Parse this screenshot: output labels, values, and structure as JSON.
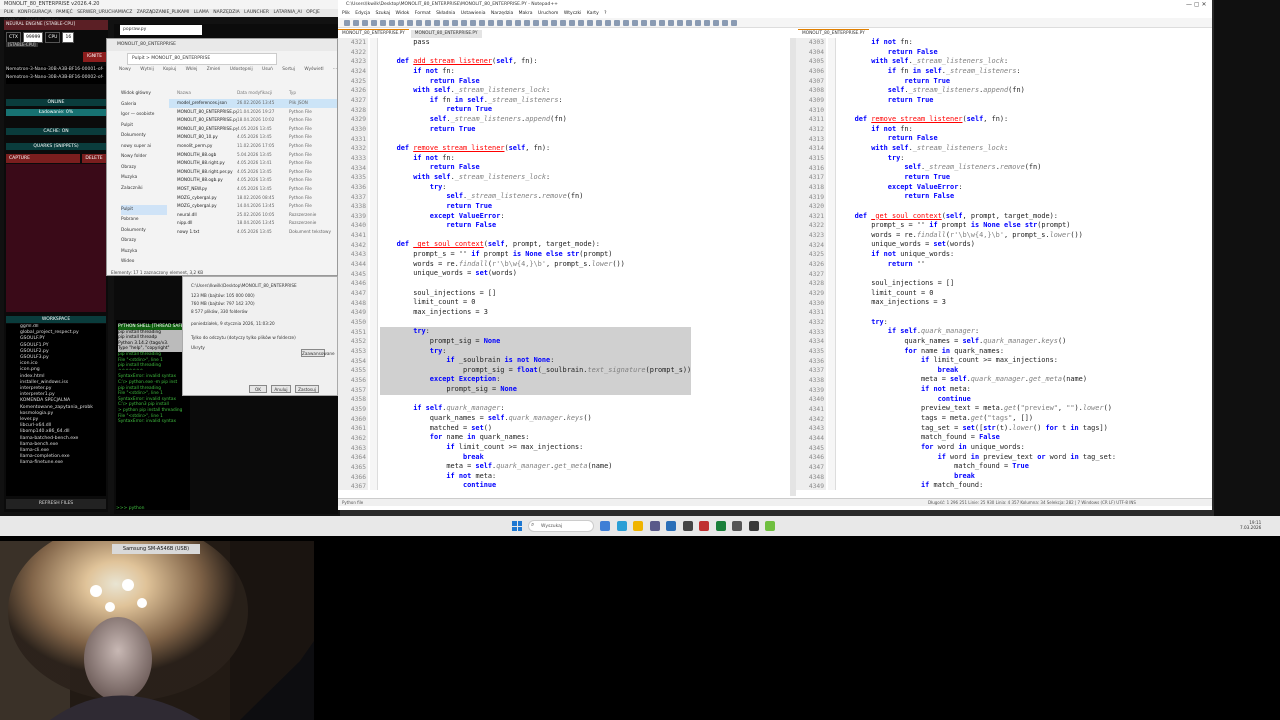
{
  "left_app": {
    "title": "MONOLIT_80_ENTERPRISE v2026.4.20",
    "menu": "PLIK KONFIGURACJA PAMIĘĆ SERWER_URUCHAMIACZ ZARZĄDZANIE_PLIKAMI LLAMA NARZĘDZIA LAUNCHER LATARNIA_AI OPCJE POMOC ZEGAR Home",
    "engine_badge": "NEURAL ENGINE [STABLE-CPU]",
    "ctx_label": "CTX",
    "ctx_value": "99999",
    "cpu_label": "CPU",
    "cpu_value": "16",
    "small_status": "[STABLE-CPU]",
    "ignite_label": "IGNITE",
    "model_lines": [
      "Nemotron-3-Nano-30B-A3B-BF16-00001-of-",
      "Nemotron-3-Nano-30B-A3B-BF16-00002-of-"
    ],
    "online_label": "ONLINE",
    "load_label": "Ładowanie: 0%",
    "cache_label": "CACHE: ON",
    "quarks_label": "QUARKS (SNIPPETS)",
    "capture_label": "CAPTURE",
    "delete_label": "DELETE",
    "workspace_label": "WORKSPACE",
    "workspace_files": [
      "ggml.dll",
      "global_project_respect.py",
      "GSOULF.PY",
      "GSOULF1.PY",
      "GSOULF2.py",
      "GSOULF3.py",
      "icon.ico",
      "icon.png",
      "index.html",
      "installer_windows.iss",
      "interpreter.py",
      "interpreter1.py",
      "KOMENDA SPECJALNA",
      "Komentowane_zapytania_probk",
      "kosmologia.py",
      "lever.py",
      "libcurl-x64.dll",
      "libomp140.x86_64.dll",
      "llama-batched-bench.exe",
      "llama-bench.exe",
      "llama-cli.exe",
      "llama-completion.exe",
      "llama-finetune.exe"
    ],
    "refresh_label": "REFRESH FILES",
    "term_input": "popraw.py",
    "term_lines": [
      "pip install threading",
      "pip install threadp",
      "Python 3.14.2 (tags/v3.",
      "Type \"help\", \"copyright\"",
      "pip install threading",
      "  File \"<stdin>\", line 1",
      "    pip install threading",
      "        ^^^^^^^",
      "SyntaxError: invalid syntax",
      "C:\\> python.exe -m pip inst",
      "pip install threading",
      "  File \"<stdin>\", line 1",
      "SyntaxError: invalid syntax",
      "C:\\> python3 pip install",
      "> python pip install threading",
      "  File \"<stdin>\", line 1",
      "SyntaxError: invalid syntax"
    ],
    "python_shell_label": "PYTHON SHELL [THREAD SAFE]",
    "prompt": ">>> python"
  },
  "explorer": {
    "tab": "MONOLIT_80_ENTERPRISE",
    "address": "Pulpit  >  MONOLIT_80_ENTERPRISE",
    "toolbar": "Nowy  Wytnij  Kopiuj  Wklej  Zmień  Udostępnij  Usuń  Sortuj  Wyświetl  ···",
    "nav": [
      "Widok główny",
      "Galeria",
      "Igor — osobiste",
      "Pulpit",
      "Dokumenty",
      "nowy super ai",
      "Nowy folder",
      "Obrazy",
      "Muzyka",
      "Zalaczniki",
      "",
      "Pulpit",
      "Pobrane",
      "Dokumenty",
      "Obrazy",
      "Muzyka",
      "Wideo"
    ],
    "columns": [
      "Nazwa",
      "Data modyfikacji",
      "Typ"
    ],
    "files": [
      [
        "model_preferences.json",
        "26.02.2026 13:45",
        "Plik JSON"
      ],
      [
        "MONOLIT_80_ENTERPRISE.py",
        "21.04.2026 19:27",
        "Python File"
      ],
      [
        "MONOLIT_80_ENTERPRISE.py",
        "18.04.2026 10:02",
        "Python File"
      ],
      [
        "MONOLIT_80_ENTERPRISE.py",
        "4.05.2026 13:45",
        "Python File"
      ],
      [
        "MONOLIT_80_10.py",
        "4.05.2026 13:45",
        "Python File"
      ],
      [
        "monolit_perm.py",
        "11.02.2026 17:05",
        "Python File"
      ],
      [
        "MONOLITH_88.ogb",
        "5.04.2026 13:45",
        "Python File"
      ],
      [
        "MONOLITH_88.right.py",
        "4.05.2026 13:41",
        "Python File"
      ],
      [
        "MONOLITH_88.right.per.py",
        "4.05.2026 13:45",
        "Python File"
      ],
      [
        "MONOLITH_88.ogb.py",
        "4.05.2026 13:45",
        "Python File"
      ],
      [
        "MOST_NEW.py",
        "4.05.2026 13:45",
        "Python File"
      ],
      [
        "MOZG_cybergal.py",
        "18.02.2026 08:45",
        "Python File"
      ],
      [
        "MOZG_cybergal.py",
        "14.04.2026 13:45",
        "Python File"
      ],
      [
        "neural.dll",
        "25.02.2026 10:05",
        "Rozszerzenie"
      ],
      [
        "nipp.dll",
        "18.04.2026 13:45",
        "Rozszerzenie"
      ],
      [
        "nowy 1.txt",
        "4.05.2026 13:45",
        "Dokument tekstowy"
      ]
    ],
    "status": "Elementy: 17   1 zaznaczony element, 3,2 KB"
  },
  "properties": {
    "location": "C:\\Users\\Ikwilk\\Desktop\\MONOLIT_80_ENTERPRISE",
    "size": "123 MB (bajtów: 105 000 000)",
    "size_disk": "760 MB (bajtów: 797 142 370)",
    "contains": "8 577 plików, 330 folderów",
    "created": "poniedziałek, 9 stycznia 2026, 11:03:20",
    "attrs": "Tylko do odczytu (dotyczy tylko plików w folderze)",
    "hidden": "Ukryty",
    "advanced": "Zaawansowane",
    "ok": "OK",
    "cancel": "Anuluj",
    "apply": "Zastosuj"
  },
  "notepad": {
    "title": "C:\\Users\\Ikwilk\\Desktop\\MONOLIT_80_ENTERPRISE\\MONOLIT_80_ENTERPRISE.PY - Notepad++",
    "menu": "Plik Edycja Szukaj Widok Format Składnia Ustawienia Narzędzia Makra Uruchom Wtyczki Karty ?",
    "tabs_left": [
      "MONOLIT_80_ENTERPRISE.PY",
      "MONOLIT_80_ENTERPRISE.PY"
    ],
    "tabs_right": [
      "MONOLIT_80_ENTERPRISE.PY"
    ],
    "status_left": "Python file",
    "status_right": "Długość: 1 296 251   Linie: 25 930     Linia: 4 357   Kolumna: 34   Selekcja: 282 | 7     Windows (CR LF)   UTF-8   INS"
  },
  "taskbar": {
    "search": "Wyszukaj",
    "time": "19:11",
    "date": "7.03.2026"
  },
  "camera": {
    "label": "Samsung SM-A546B (USB)"
  },
  "colors": {
    "keyword": "#0000ff",
    "function": "#ff0000",
    "selection": "#d0d0d0",
    "teal": "#0a3c3c",
    "red": "#7a1e1e"
  }
}
